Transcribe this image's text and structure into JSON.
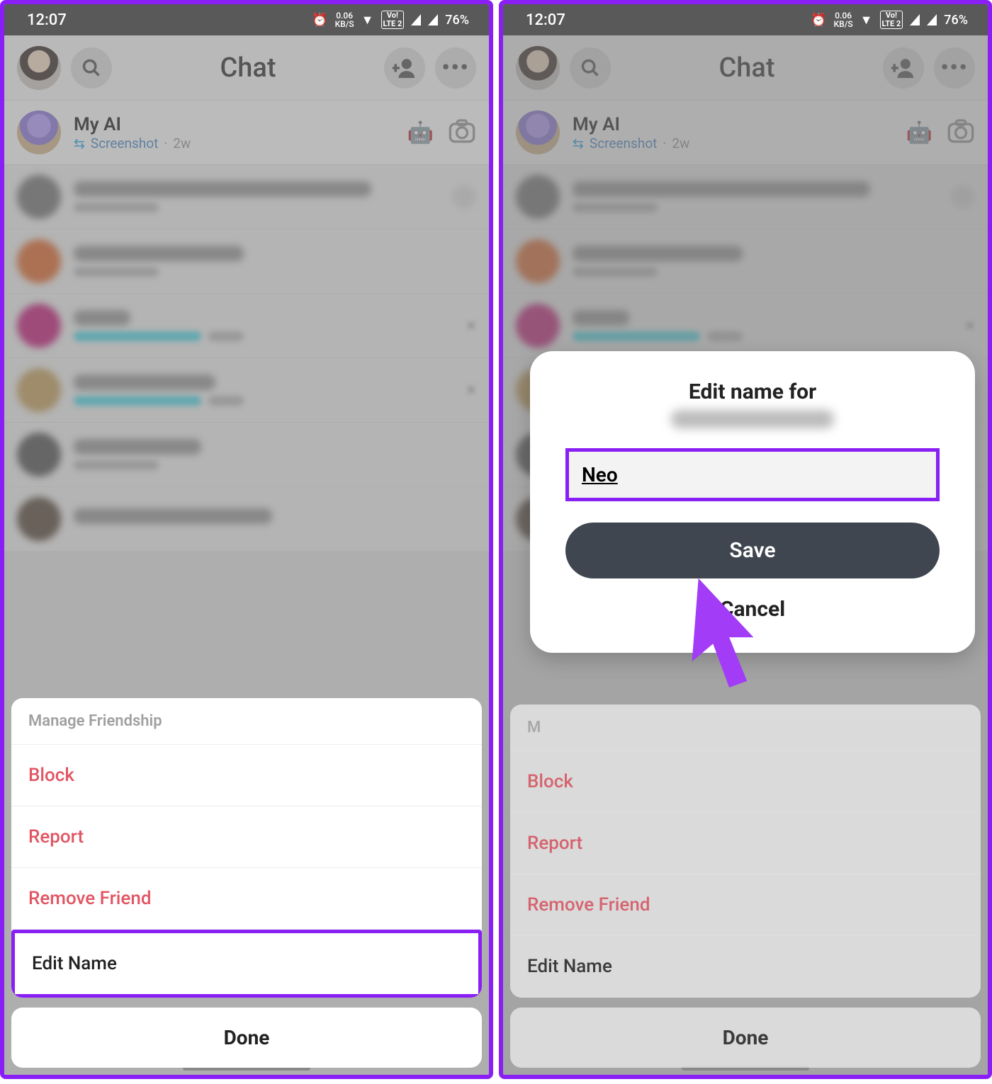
{
  "status": {
    "time": "12:07",
    "kbs_top": "0.06",
    "kbs_bot": "KB/S",
    "lte_top": "Vo!",
    "lte_bot": "LTE 2",
    "battery": "76%"
  },
  "header": {
    "title": "Chat"
  },
  "my_ai": {
    "name": "My AI",
    "sub_action": "Screenshot",
    "sub_time": "2w"
  },
  "sheet": {
    "title": "Manage Friendship",
    "block": "Block",
    "report": "Report",
    "remove": "Remove Friend",
    "edit": "Edit Name",
    "done": "Done"
  },
  "dialog": {
    "title": "Edit name for",
    "value": "Neo",
    "save": "Save",
    "cancel": "Cancel"
  }
}
